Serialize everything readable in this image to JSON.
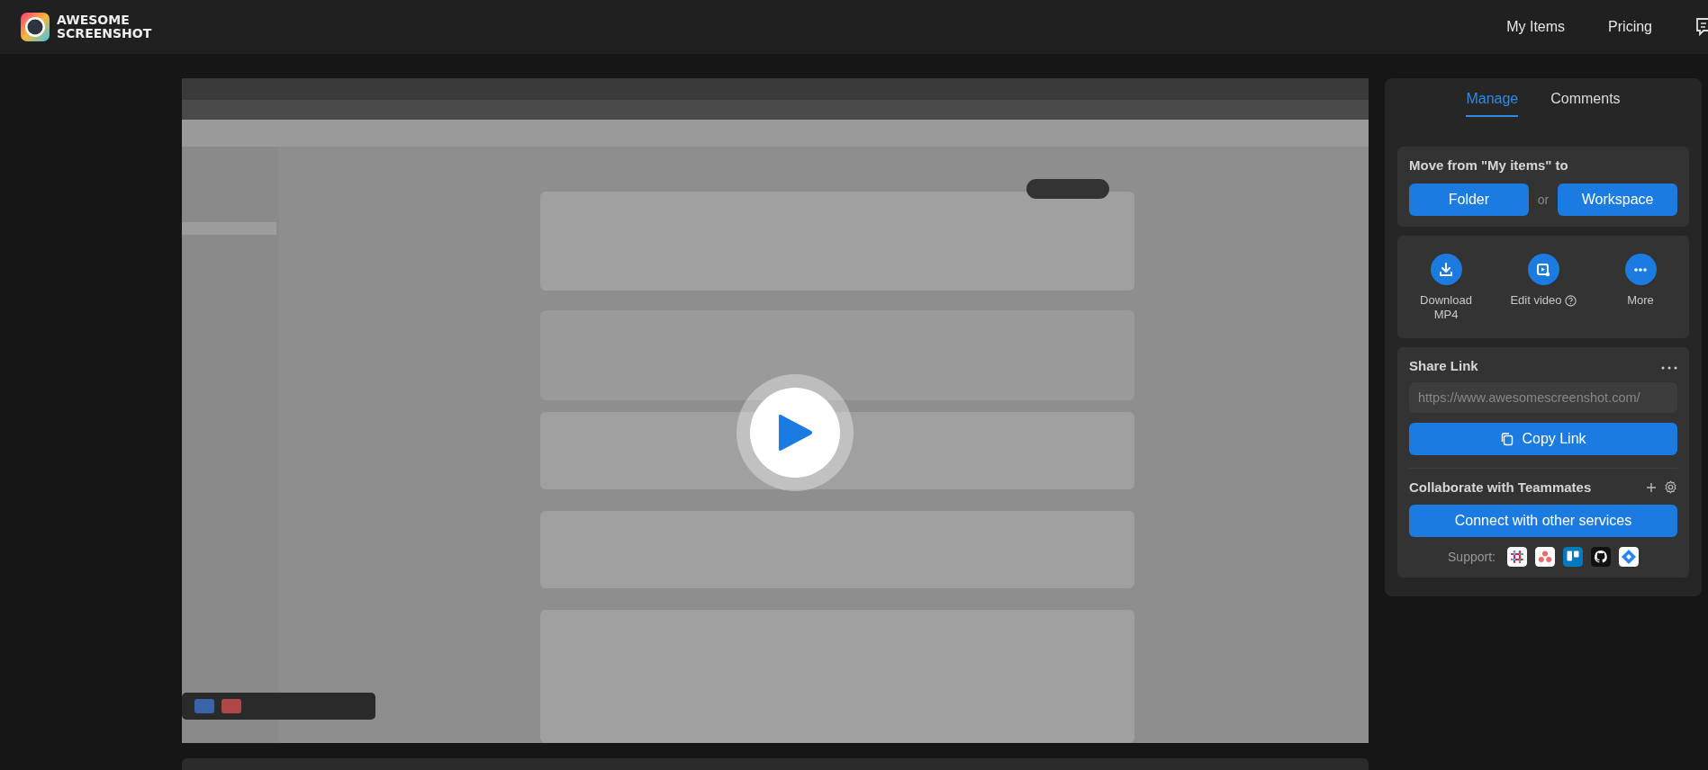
{
  "header": {
    "logo_line1": "AWESOME",
    "logo_line2": "SCREENSHOT",
    "nav": [
      "My Items",
      "Pricing"
    ]
  },
  "panel": {
    "tabs": [
      {
        "label": "Manage",
        "selected": true
      },
      {
        "label": "Comments",
        "selected": false
      }
    ],
    "move": {
      "title": "Move from \"My items\" to",
      "buttons": [
        "Folder",
        "Workspace"
      ],
      "separator": "or"
    },
    "actions": [
      {
        "kind": "download",
        "label": "Download MP4"
      },
      {
        "kind": "edit",
        "label": "Edit video"
      },
      {
        "kind": "more",
        "label": "More"
      }
    ],
    "share": {
      "title": "Share Link",
      "url": "https://www.awesomescreenshot.com/",
      "copy": "Copy Link"
    },
    "collab": {
      "title": "Collaborate with Teammates",
      "button": "Connect with other services",
      "support_label": "Support:"
    }
  }
}
